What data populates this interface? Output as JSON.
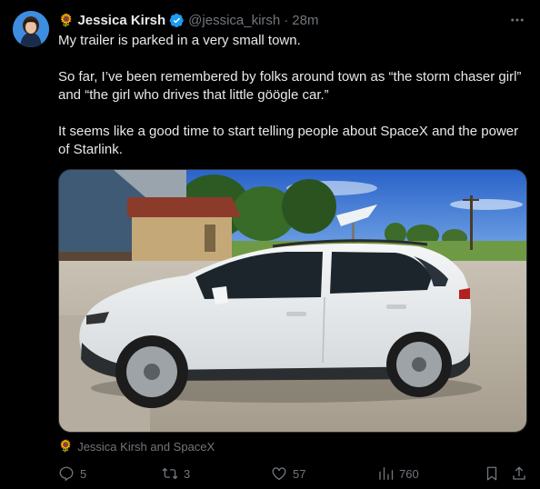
{
  "author": {
    "display_name": "Jessica Kirsh",
    "handle": "@jessica_kirsh",
    "separator": "·",
    "timestamp": "28m",
    "emoji": "🌻"
  },
  "tweet": {
    "paragraphs": [
      "My trailer is parked in a very small town.",
      "So far, I’ve been remembered by folks around town as “the storm chaser girl” and “the girl who drives that little göögle car.”",
      "It seems like a good time to start telling people about SpaceX and the power of Starlink."
    ]
  },
  "media_tags": {
    "emoji": "🌻",
    "text": "Jessica Kirsh and SpaceX"
  },
  "actions": {
    "replies": "5",
    "reposts": "3",
    "likes": "57",
    "views": "760"
  },
  "icons": {
    "more": "more-horizontal-icon",
    "verified": "verified-badge-icon",
    "reply": "reply-icon",
    "repost": "repost-icon",
    "like": "heart-icon",
    "views": "views-chart-icon",
    "bookmark": "bookmark-icon",
    "share": "share-icon"
  },
  "colors": {
    "background": "#000000",
    "primary_text": "#e7e9ea",
    "secondary_text": "#71767b",
    "verified": "#1d9bf0",
    "border": "#2f3336"
  }
}
